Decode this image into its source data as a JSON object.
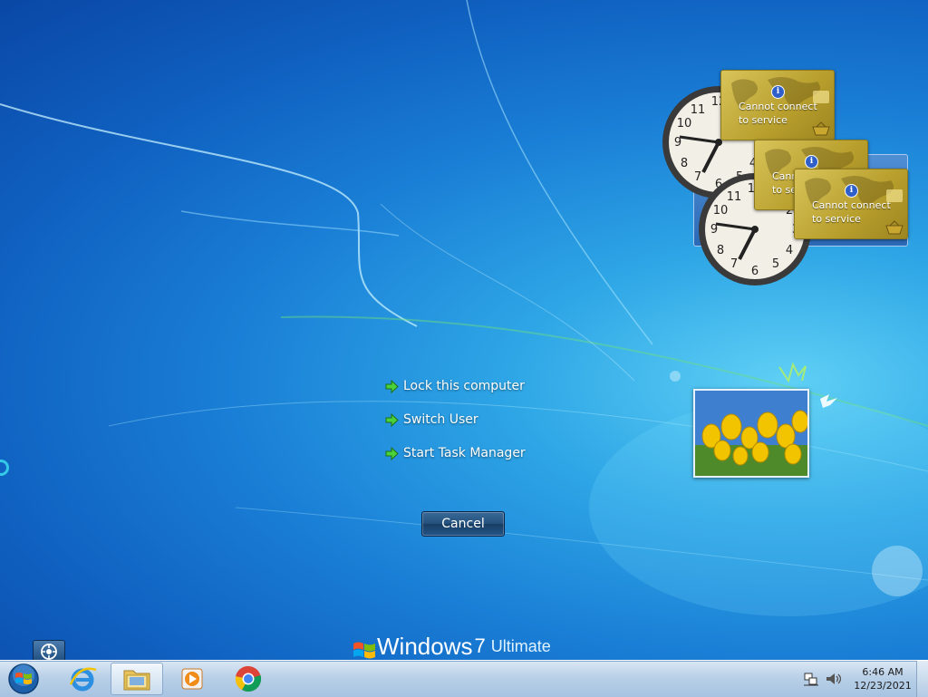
{
  "security_options": {
    "items": [
      {
        "label": "Lock this computer"
      },
      {
        "label": "Switch User"
      },
      {
        "label": "Start Task Manager"
      }
    ],
    "cancel_label": "Cancel"
  },
  "branding": {
    "windows": "Windows",
    "version": "7",
    "edition": "Ultimate"
  },
  "gadgets": {
    "feed_message_line1": "Cannot connect",
    "feed_message_line2": "to service",
    "feed_message_partial_line1": "Canno",
    "feed_message_partial_line2": "to se"
  },
  "taskbar": {
    "time": "6:46 AM",
    "date": "12/23/2021",
    "items": [
      {
        "name": "internet-explorer"
      },
      {
        "name": "windows-explorer",
        "active": true
      },
      {
        "name": "windows-media-player"
      },
      {
        "name": "google-chrome"
      }
    ]
  },
  "colors": {
    "arrow": "#4bd13a",
    "desktop": "#1a7fd6",
    "feed_gold": "#c7b040"
  }
}
